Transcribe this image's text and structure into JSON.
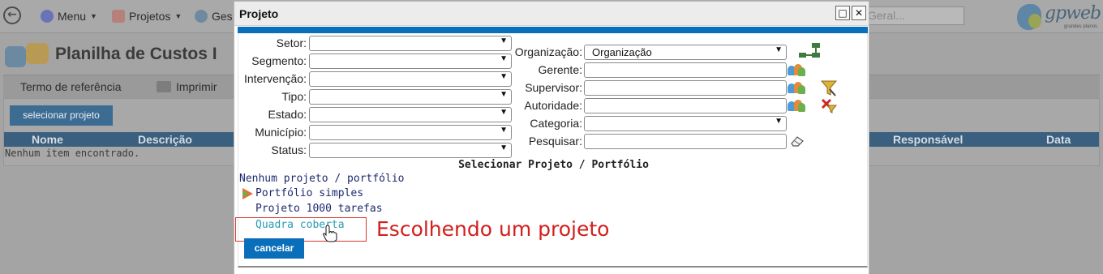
{
  "topbar": {
    "menu_label": "Menu",
    "projects_label": "Projetos",
    "management_label": "Ges",
    "search_placeholder": "Geral..."
  },
  "logo": {
    "text": "gpweb",
    "subtitle": "grandes planos"
  },
  "page": {
    "title": "Planilha de Custos I",
    "tabs": [
      "Termo de referência",
      "Imprimir"
    ],
    "select_button": "selecionar projeto",
    "table": {
      "columns": [
        "Nome",
        "Descrição",
        "Responsável",
        "Data"
      ],
      "empty_message": "Nenhum item encontrado."
    }
  },
  "dialog": {
    "title": "Projeto",
    "left_filters": [
      {
        "label": "Setor:",
        "value": ""
      },
      {
        "label": "Segmento:",
        "value": ""
      },
      {
        "label": "Intervenção:",
        "value": ""
      },
      {
        "label": "Tipo:",
        "value": ""
      },
      {
        "label": "Estado:",
        "value": ""
      },
      {
        "label": "Município:",
        "value": ""
      },
      {
        "label": "Status:",
        "value": ""
      }
    ],
    "right_filters": {
      "organizacao_label": "Organização:",
      "organizacao_value": "Organização",
      "gerente_label": "Gerente:",
      "supervisor_label": "Supervisor:",
      "autoridade_label": "Autoridade:",
      "categoria_label": "Categoria:",
      "pesquisar_label": "Pesquisar:"
    },
    "section_title": "Selecionar Projeto / Portfólio",
    "tree": {
      "root": "Nenhum projeto / portfólio",
      "portfolio": "Portfólio simples",
      "projects": [
        "Projeto 1000 tarefas",
        "Quadra coberta"
      ]
    },
    "cancel_button": "cancelar"
  },
  "annotation": "Escolhendo um projeto",
  "colors": {
    "dialog_accent": "#0a6fba",
    "annotation": "#d2201d",
    "link": "#1e2a6e",
    "link_hover": "#2a9bb0"
  }
}
